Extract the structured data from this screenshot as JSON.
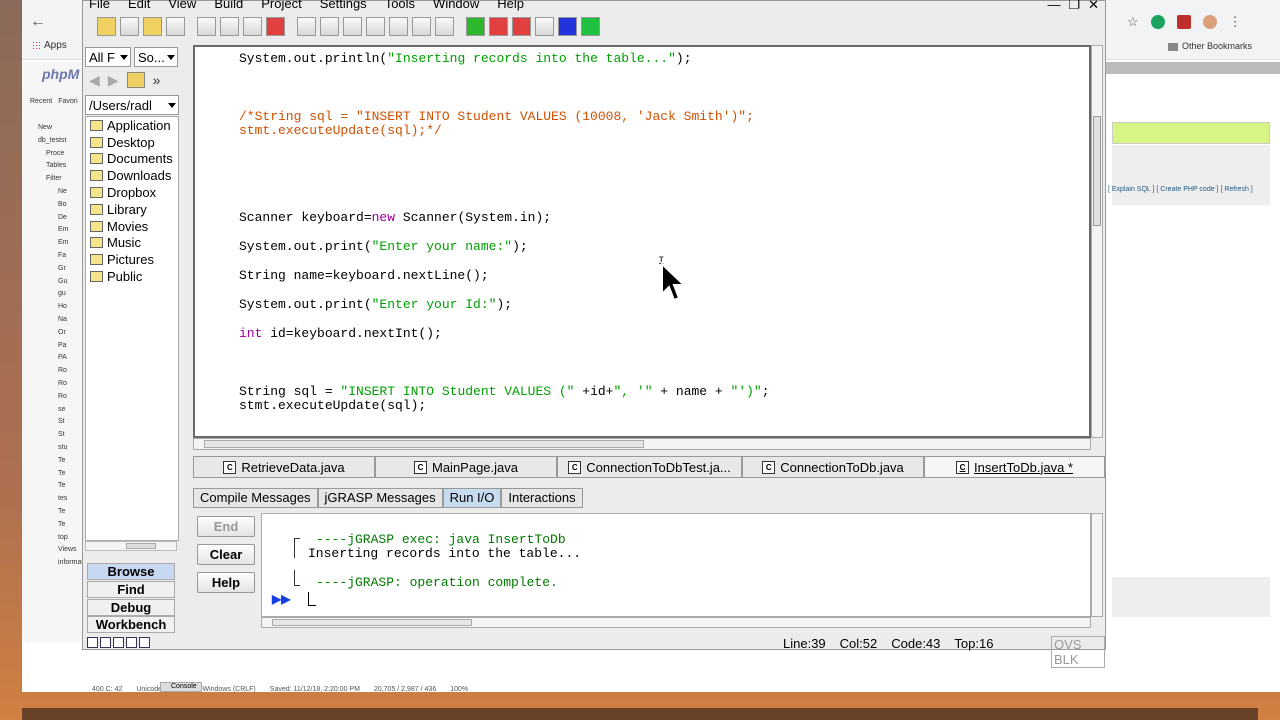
{
  "browser": {
    "apps_label": "Apps",
    "other_bookmarks": "Other Bookmarks",
    "pma_links": "[ Explain SQL ] [ Create PHP code ] [ Refresh ]",
    "pma_logo": "phpM",
    "pma_tabs": [
      "Recent",
      "Favori"
    ],
    "pma_tree": [
      "New",
      "db_testst",
      "Proce",
      "Tables",
      "Filter",
      "Ne",
      "Bo",
      "De",
      "Em",
      "Em",
      "Fa",
      "Gr",
      "Gu",
      "gu",
      "Ho",
      "Na",
      "Or",
      "Pa",
      "PA",
      "Ro",
      "Ro",
      "Ro",
      "se",
      "St",
      "St",
      "stu",
      "Te",
      "Te",
      "Te",
      "tes",
      "Te",
      "Te",
      "top",
      "Views",
      "informatio"
    ],
    "bottom_status": [
      "400 C: 42",
      "Unicode (UTF-8)",
      "Windows (CRLF)",
      "Saved: 11/12/18, 2:20:00 PM",
      "20,705 / 2,987 / 436",
      "100%"
    ],
    "console_tab": "Console"
  },
  "menubar": [
    "File",
    "Edit",
    "View",
    "Build",
    "Project",
    "Settings",
    "Tools",
    "Window",
    "Help"
  ],
  "window_controls": [
    "—",
    "❐",
    "✕"
  ],
  "left_panel": {
    "filter_dropdown": "All F",
    "sort_dropdown": "So...",
    "path": "/Users/radl",
    "files": [
      "Application",
      "Desktop",
      "Documents",
      "Downloads",
      "Dropbox",
      "Library",
      "Movies",
      "Music",
      "Pictures",
      "Public"
    ],
    "buttons": [
      "Browse",
      "Find",
      "Debug",
      "Workbench"
    ]
  },
  "editor": {
    "lines": {
      "l1_a": "System.out.println(",
      "l1_s": "\"Inserting records into the table...\"",
      "l1_b": ");",
      "l2": "/*String sql = \"INSERT INTO Student VALUES (10008, 'Jack Smith')\";",
      "l3": "stmt.executeUpdate(sql);*/",
      "l4_a": "Scanner keyboard=",
      "l4_k": "new",
      "l4_b": " Scanner(System.in);",
      "l5_a": "System.out.print(",
      "l5_s": "\"Enter your name:\"",
      "l5_b": ");",
      "l6": "String name=keyboard.nextLine();",
      "l7_a": "System.out.print(",
      "l7_s": "\"Enter your Id:\"",
      "l7_b": ");",
      "l8_k": "int",
      "l8_b": " id=keyboard.nextInt();",
      "l9_a": "String sql = ",
      "l9_s1": "\"INSERT INTO Student VALUES (\"",
      "l9_b": " +id+",
      "l9_s2": "\", '\"",
      "l9_c": " + name + ",
      "l9_s3": "\"')\"",
      "l9_d": ";",
      "l10": "stmt.executeUpdate(sql);"
    }
  },
  "file_tabs": [
    {
      "label": "RetrieveData.java",
      "active": false
    },
    {
      "label": "MainPage.java",
      "active": false
    },
    {
      "label": "ConnectionToDbTest.ja...",
      "active": false
    },
    {
      "label": "ConnectionToDb.java",
      "active": false
    },
    {
      "label": "InsertToDb.java *",
      "active": true
    }
  ],
  "bottom_tabs": [
    "Compile Messages",
    "jGRASP Messages",
    "Run I/O",
    "Interactions"
  ],
  "active_bottom_tab": "Run I/O",
  "side_buttons": [
    "End",
    "Clear",
    "Help"
  ],
  "console": {
    "line1": "----jGRASP exec: java InsertToDb",
    "line2": "Inserting records into the table...",
    "line3": "----jGRASP: operation complete.",
    "prompt": "▶▶"
  },
  "status": {
    "line": "Line:39",
    "col": "Col:52",
    "code": "Code:43",
    "top": "Top:16",
    "mode": "OVS BLK"
  },
  "colors": {
    "string": "#00a000",
    "comment": "#d05000",
    "keyword": "#a000a0",
    "active_tab": "#c8dcf0"
  }
}
